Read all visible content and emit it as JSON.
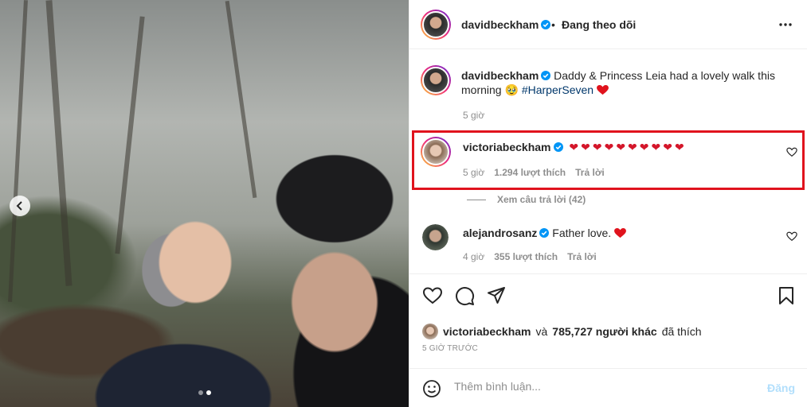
{
  "header": {
    "username": "davidbeckham",
    "separator": "•",
    "follow_status": "Đang theo dõi"
  },
  "caption": {
    "username": "davidbeckham",
    "text": "Daddy & Princess Leia had a lovely walk this morning",
    "emoji": "🥹",
    "hashtag": "#HarperSeven",
    "time": "5 giờ"
  },
  "comments": [
    {
      "username": "victoriabeckham",
      "hearts": "❤❤❤❤❤❤❤❤❤❤",
      "time": "5 giờ",
      "likes": "1.294 lượt thích",
      "reply": "Trả lời",
      "view_replies": "Xem câu trả lời (42)"
    },
    {
      "username": "alejandrosanz",
      "text": "Father love.",
      "time": "4 giờ",
      "likes": "355 lượt thích",
      "reply": "Trả lời"
    }
  ],
  "likes_summary": {
    "username": "victoriabeckham",
    "connector": "và",
    "others": "785,727 người khác",
    "suffix": "đã thích"
  },
  "post_time": "5 GIỜ TRƯỚC",
  "comment_input": {
    "placeholder": "Thêm bình luận...",
    "post_label": "Đăng"
  },
  "colors": {
    "verified": "#0095f6",
    "heart": "#ed4956",
    "highlight": "#e0131d",
    "hashtag": "#00376b"
  }
}
